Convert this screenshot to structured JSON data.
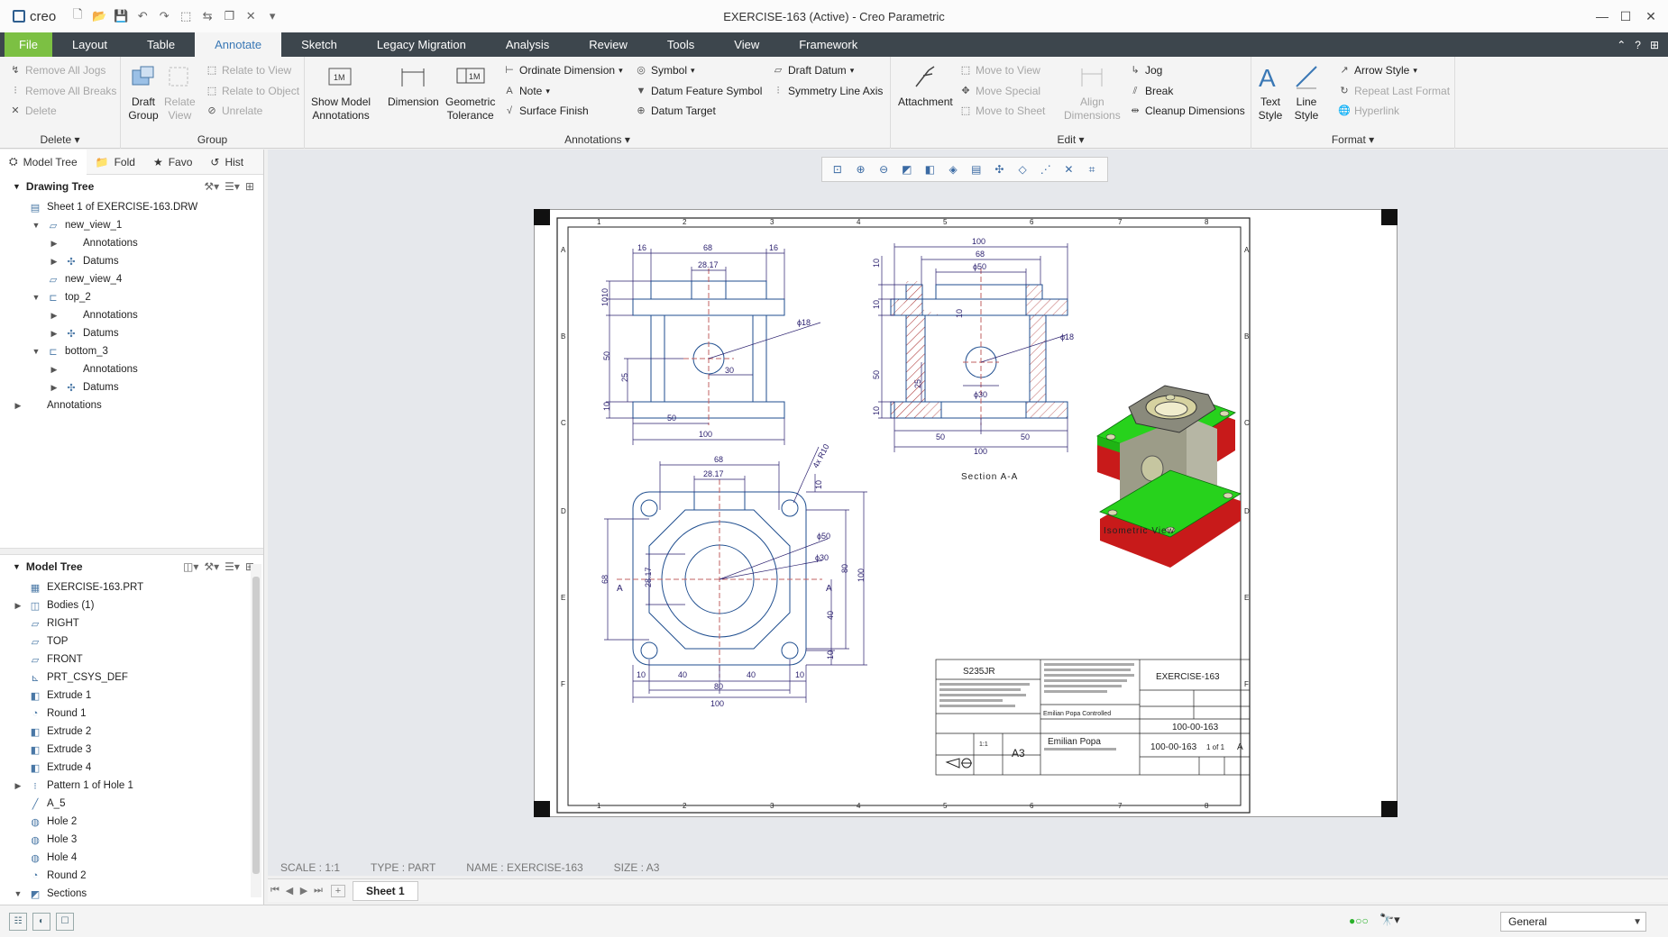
{
  "app": {
    "logo": "creo",
    "window_title": "EXERCISE-163 (Active) - Creo Parametric"
  },
  "menu": {
    "tabs": [
      "File",
      "Layout",
      "Table",
      "Annotate",
      "Sketch",
      "Legacy Migration",
      "Analysis",
      "Review",
      "Tools",
      "View",
      "Framework"
    ],
    "active": "Annotate"
  },
  "ribbon": {
    "delete": {
      "remove_all_jogs": "Remove All Jogs",
      "remove_all_breaks": "Remove All Breaks",
      "delete": "Delete",
      "label": "Delete"
    },
    "group": {
      "draft_group": "Draft\nGroup",
      "relate_view": "Relate\nView",
      "relate_to_view": "Relate to View",
      "relate_to_object": "Relate to Object",
      "unrelate": "Unrelate",
      "label": "Group"
    },
    "annotations": {
      "show_model_annotations": "Show Model\nAnnotations",
      "dimension": "Dimension",
      "geometric_tolerance": "Geometric\nTolerance",
      "ordinate_dimension": "Ordinate Dimension",
      "note": "Note",
      "surface_finish": "Surface Finish",
      "symbol": "Symbol",
      "datum_feature_symbol": "Datum Feature Symbol",
      "datum_target": "Datum Target",
      "draft_datum": "Draft Datum",
      "symmetry_line_axis": "Symmetry Line Axis",
      "label": "Annotations"
    },
    "edit": {
      "attachment": "Attachment",
      "move_to_view": "Move to View",
      "move_special": "Move Special",
      "move_to_sheet": "Move to Sheet",
      "align_dimensions": "Align\nDimensions",
      "jog": "Jog",
      "break": "Break",
      "cleanup_dimensions": "Cleanup Dimensions",
      "label": "Edit"
    },
    "format": {
      "text_style": "Text\nStyle",
      "line_style": "Line\nStyle",
      "arrow_style": "Arrow Style",
      "repeat_last_format": "Repeat Last Format",
      "hyperlink": "Hyperlink",
      "label": "Format"
    }
  },
  "left_tabs": [
    "Model Tree",
    "Fold",
    "Favo",
    "Hist"
  ],
  "drawing_tree": {
    "title": "Drawing Tree",
    "items": [
      {
        "label": "Sheet 1 of EXERCISE-163.DRW",
        "indent": 0,
        "tog": "",
        "icon": "sheet"
      },
      {
        "label": "new_view_1",
        "indent": 1,
        "tog": "▼",
        "icon": "view"
      },
      {
        "label": "Annotations",
        "indent": 2,
        "tog": "▶",
        "icon": ""
      },
      {
        "label": "Datums",
        "indent": 2,
        "tog": "▶",
        "icon": "datum"
      },
      {
        "label": "new_view_4",
        "indent": 1,
        "tog": "",
        "icon": "view"
      },
      {
        "label": "top_2",
        "indent": 1,
        "tog": "▼",
        "icon": "view2"
      },
      {
        "label": "Annotations",
        "indent": 2,
        "tog": "▶",
        "icon": ""
      },
      {
        "label": "Datums",
        "indent": 2,
        "tog": "▶",
        "icon": "datum"
      },
      {
        "label": "bottom_3",
        "indent": 1,
        "tog": "▼",
        "icon": "view2"
      },
      {
        "label": "Annotations",
        "indent": 2,
        "tog": "▶",
        "icon": ""
      },
      {
        "label": "Datums",
        "indent": 2,
        "tog": "▶",
        "icon": "datum"
      },
      {
        "label": "Annotations",
        "indent": 0,
        "tog": "▶",
        "icon": ""
      }
    ]
  },
  "model_tree": {
    "title": "Model Tree",
    "items": [
      {
        "label": "EXERCISE-163.PRT",
        "tog": "",
        "icon": "part"
      },
      {
        "label": "Bodies (1)",
        "tog": "▶",
        "icon": "body"
      },
      {
        "label": "RIGHT",
        "tog": "",
        "icon": "plane"
      },
      {
        "label": "TOP",
        "tog": "",
        "icon": "plane"
      },
      {
        "label": "FRONT",
        "tog": "",
        "icon": "plane"
      },
      {
        "label": "PRT_CSYS_DEF",
        "tog": "",
        "icon": "csys"
      },
      {
        "label": "Extrude 1",
        "tog": "",
        "icon": "extrude"
      },
      {
        "label": "Round 1",
        "tog": "",
        "icon": "round"
      },
      {
        "label": "Extrude 2",
        "tog": "",
        "icon": "extrude"
      },
      {
        "label": "Extrude 3",
        "tog": "",
        "icon": "extrude"
      },
      {
        "label": "Extrude 4",
        "tog": "",
        "icon": "extrude"
      },
      {
        "label": "Pattern 1 of Hole 1",
        "tog": "▶",
        "icon": "pattern"
      },
      {
        "label": "A_5",
        "tog": "",
        "icon": "axis"
      },
      {
        "label": "Hole 2",
        "tog": "",
        "icon": "hole"
      },
      {
        "label": "Hole 3",
        "tog": "",
        "icon": "hole"
      },
      {
        "label": "Hole 4",
        "tog": "",
        "icon": "hole"
      },
      {
        "label": "Round 2",
        "tog": "",
        "icon": "round"
      },
      {
        "label": "Sections",
        "tog": "▼",
        "icon": "sections"
      }
    ]
  },
  "drawing": {
    "front": {
      "d16a": "16",
      "d68": "68",
      "d16b": "16",
      "d2817": "28.17",
      "d10a": "10",
      "d10b": "10",
      "d50v": "50",
      "d25": "25",
      "d10c": "10",
      "d30": "30",
      "phi18": "ϕ18",
      "d50h": "50",
      "d100": "100"
    },
    "section": {
      "d100t": "100",
      "d68": "68",
      "phi50": "ϕ50",
      "d10a": "10",
      "d10b": "10",
      "d10c": "10",
      "d50v": "50",
      "d25": "25",
      "d10d": "10",
      "phi18": "ϕ18",
      "phi30": "ϕ30",
      "d50l": "50",
      "d50r": "50",
      "d100b": "100",
      "caption": "Section A-A"
    },
    "top": {
      "d68": "68",
      "d2817": "28.17",
      "r10": "4x R10",
      "d10a": "10",
      "phi50": "ϕ50",
      "phi30": "ϕ30",
      "d80v": "80",
      "d100v": "100",
      "d40v": "40",
      "d10v": "10",
      "d68v": "68",
      "d2817v": "28.17",
      "d10a2": "10",
      "d40a": "40",
      "d40b": "40",
      "d10b": "10",
      "d80h": "80",
      "d100h": "100",
      "markA": "A"
    },
    "iso_caption": "Isometric View",
    "cols": [
      "1",
      "2",
      "3",
      "4",
      "5",
      "6",
      "7",
      "8"
    ],
    "rows": [
      "A",
      "B",
      "C",
      "D",
      "E",
      "F"
    ],
    "titleblock": {
      "material": "S235JR",
      "description": "EXERCISE-163",
      "part_number": "100-00-163",
      "drawing_number": "100-00-163",
      "size": "A3",
      "author": "Emilian Popa",
      "sheet": "1 of 1",
      "rev": "A",
      "scale": "1:1",
      "inspected": "Emilian Popa Controlled"
    }
  },
  "status": {
    "scale": "SCALE : 1:1",
    "type": "TYPE : PART",
    "name": "NAME : EXERCISE-163",
    "size": "SIZE : A3"
  },
  "sheet_tab": "Sheet 1",
  "filter": "General",
  "colors": {
    "accent": "#7cc043",
    "menubar": "#3d464d",
    "active_tab": "#3a78b5",
    "drawing_line": "#1f4e8f",
    "dim": "#2a1f6e",
    "iso_green": "#27d21c",
    "iso_red": "#c81a1a"
  }
}
